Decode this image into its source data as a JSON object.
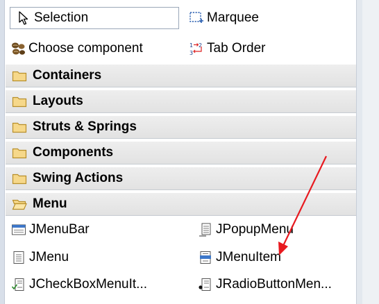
{
  "tools": {
    "selection": "Selection",
    "marquee": "Marquee",
    "choose_component": "Choose component",
    "tab_order": "Tab Order"
  },
  "categories": [
    "Containers",
    "Layouts",
    "Struts & Springs",
    "Components",
    "Swing Actions",
    "Menu"
  ],
  "menu_components": [
    "JMenuBar",
    "JPopupMenu",
    "JMenu",
    "JMenuItem",
    "JCheckBoxMenuIt...",
    "JRadioButtonMen..."
  ],
  "colors": {
    "folder_fill": "#f6d88a",
    "folder_stroke": "#b88f2a",
    "annotation_arrow": "#e8191f"
  },
  "icons": {
    "selection": "arrow-cursor-icon",
    "marquee": "marquee-icon",
    "choose_component": "beans-icon",
    "tab_order": "tab-order-icon",
    "closed_folder": "folder-icon",
    "open_folder": "folder-open-icon"
  }
}
